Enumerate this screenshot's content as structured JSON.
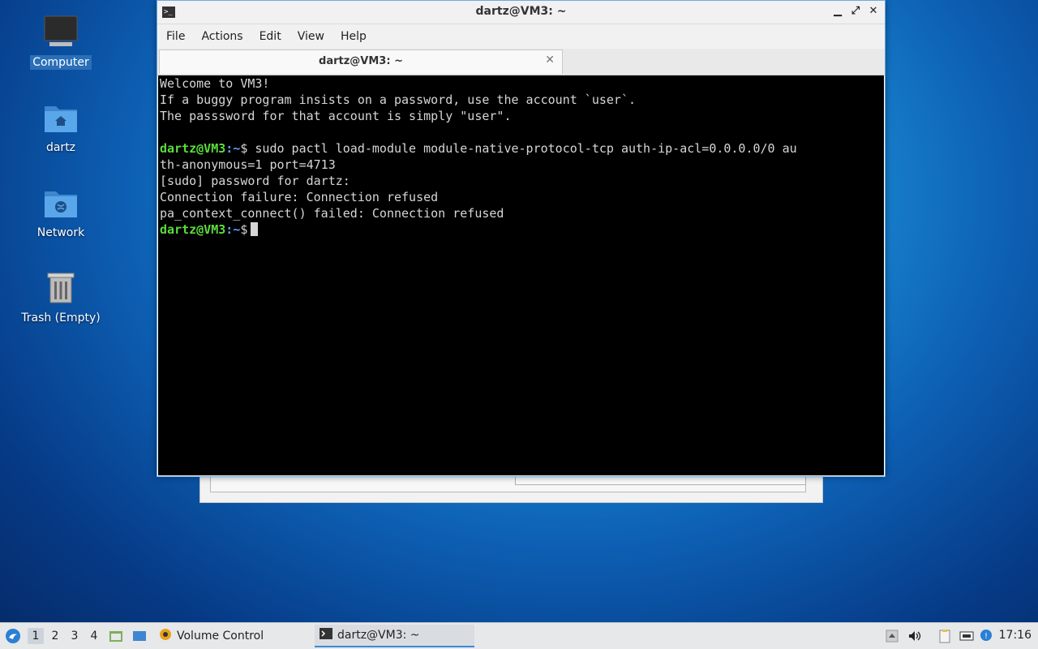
{
  "desktop": {
    "icons": [
      {
        "label": "Computer",
        "icon": "monitor-icon",
        "selected": true
      },
      {
        "label": "dartz",
        "icon": "home-folder-icon"
      },
      {
        "label": "Network",
        "icon": "network-folder-icon"
      },
      {
        "label": "Trash (Empty)",
        "icon": "trash-icon"
      }
    ]
  },
  "terminal_window": {
    "title": "dartz@VM3: ~",
    "menu": [
      "File",
      "Actions",
      "Edit",
      "View",
      "Help"
    ],
    "tab_title": "dartz@VM3: ~",
    "controls": {
      "minimize": "▁",
      "maximize": "⤢",
      "close": "✕"
    },
    "output": [
      "Welcome to VM3!",
      "If a buggy program insists on a password, use the account `user`.",
      "The passsword for that account is simply \"user\".",
      "",
      "th-anonymous=1 port=4713",
      "[sudo] password for dartz:",
      "Connection failure: Connection refused",
      "pa_context_connect() failed: Connection refused"
    ],
    "prompt_user": "dartz@VM3",
    "prompt_path": ":~",
    "prompt_symbol": "$",
    "command": " sudo pactl load-module module-native-protocol-tcp auth-ip-acl=0.0.0.0/0 au"
  },
  "taskbar": {
    "workspaces": [
      "1",
      "2",
      "3",
      "4"
    ],
    "active_workspace": "1",
    "tasks": [
      {
        "label": "Volume Control",
        "icon": "volume-control-icon"
      },
      {
        "label": "dartz@VM3: ~",
        "icon": "terminal-icon",
        "active": true
      }
    ],
    "clock": "17:16"
  },
  "colors": {
    "prompt_user": "#5bdc3c",
    "prompt_path": "#5aa0ff",
    "terminal_bg": "#000000",
    "accent": "#3b8ad9"
  }
}
